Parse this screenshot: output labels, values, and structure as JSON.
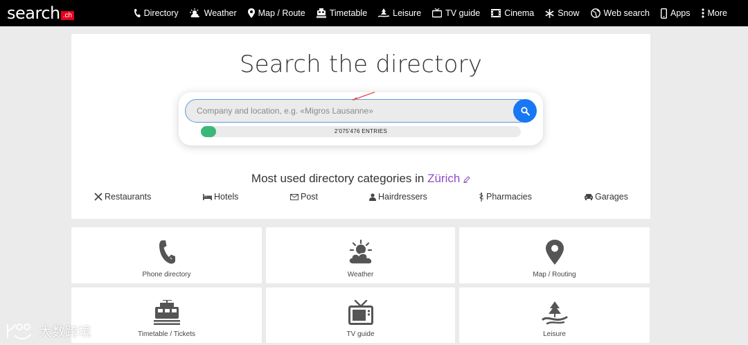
{
  "logo": {
    "text": "search",
    "badge": ".ch"
  },
  "nav": [
    {
      "label": "Directory",
      "icon": "phone-icon"
    },
    {
      "label": "Weather",
      "icon": "weather-icon"
    },
    {
      "label": "Map / Route",
      "icon": "map-pin-icon"
    },
    {
      "label": "Timetable",
      "icon": "train-icon"
    },
    {
      "label": "Leisure",
      "icon": "leisure-icon"
    },
    {
      "label": "TV guide",
      "icon": "tv-icon"
    },
    {
      "label": "Cinema",
      "icon": "film-icon"
    },
    {
      "label": "Snow",
      "icon": "snowflake-icon"
    },
    {
      "label": "Web search",
      "icon": "globe-icon"
    },
    {
      "label": "Apps",
      "icon": "mobile-icon"
    },
    {
      "label": "More",
      "icon": "vertical-dots-icon"
    }
  ],
  "search": {
    "headline": "Search the directory",
    "placeholder": "Company and location, e.g. «Migros Lausanne»",
    "entries_label": "2'075'476  ENTRIES",
    "entries_progress": 0.047
  },
  "categories": {
    "title_prefix": "Most used directory categories in ",
    "city": "Zürich",
    "items": [
      {
        "label": "Restaurants",
        "icon": "cutlery-icon"
      },
      {
        "label": "Hotels",
        "icon": "bed-icon"
      },
      {
        "label": "Post",
        "icon": "envelope-icon"
      },
      {
        "label": "Hairdressers",
        "icon": "person-icon"
      },
      {
        "label": "Pharmacies",
        "icon": "caduceus-icon"
      },
      {
        "label": "Garages",
        "icon": "car-icon"
      }
    ]
  },
  "tiles": [
    {
      "label": "Phone directory",
      "icon": "phone-icon"
    },
    {
      "label": "Weather",
      "icon": "weather-icon"
    },
    {
      "label": "Map / Routing",
      "icon": "map-pin-icon"
    },
    {
      "label": "Timetable / Tickets",
      "icon": "train-icon"
    },
    {
      "label": "TV guide",
      "icon": "tv-icon"
    },
    {
      "label": "Leisure",
      "icon": "leisure-icon"
    }
  ],
  "watermark": {
    "text": "大数跨境"
  },
  "colors": {
    "accent_blue": "#1877f2",
    "progress_green": "#3bb879",
    "city_purple": "#8f4bc8",
    "logo_red": "#e5001c"
  }
}
